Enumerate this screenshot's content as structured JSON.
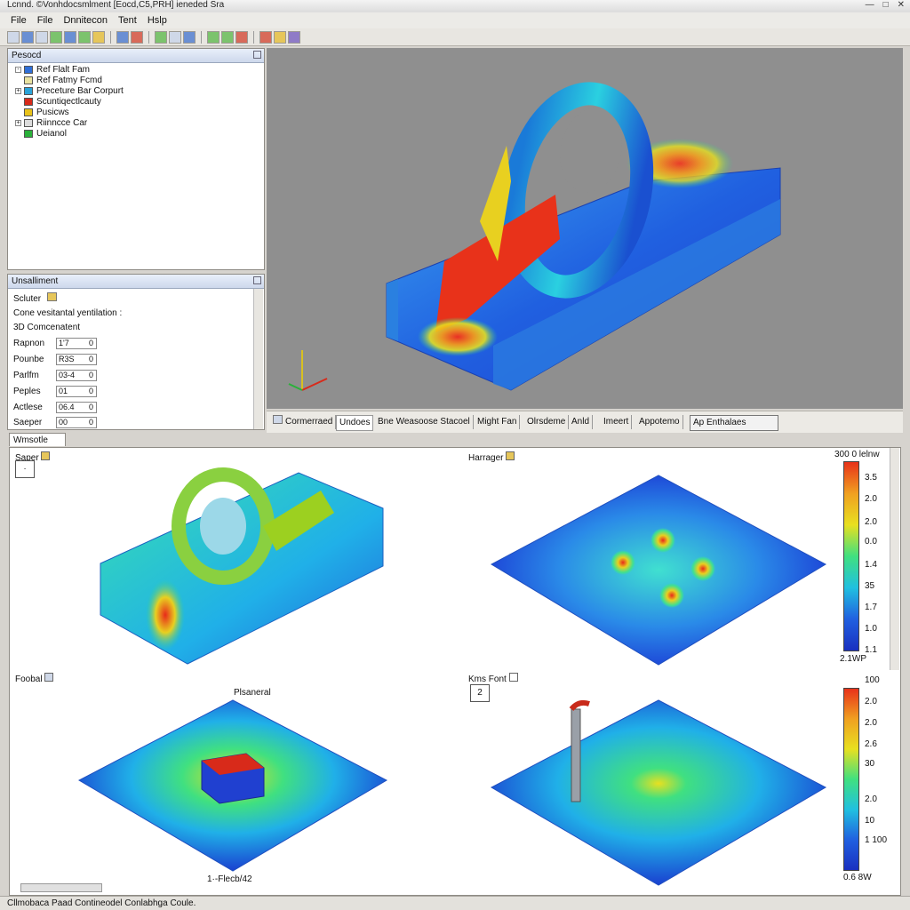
{
  "window": {
    "title": "Lcnnd. ©Vonhdocsmlment [Eocd,C5,PRH] ieneded Sra"
  },
  "menu": [
    "File",
    "File",
    "Dnnitecon",
    "Tent",
    "Hslp"
  ],
  "project_tree": {
    "title": "Pesocd",
    "items": [
      {
        "label": "Ref Flalt Fam",
        "color": "#2f6fd8"
      },
      {
        "label": "Ref Fatmy Fcmd",
        "color": "#e9e2a0"
      },
      {
        "label": "Preceture Bar Corpurt",
        "color": "#2aa3d8"
      },
      {
        "label": "Scuntiqectlcauty",
        "color": "#d82a1a"
      },
      {
        "label": "Pusicws",
        "color": "#e8c21a"
      },
      {
        "label": "Riinncce Car",
        "color": "#dcdcdc"
      },
      {
        "label": "Ueianol",
        "color": "#2ab13a"
      }
    ]
  },
  "properties": {
    "title": "Unsalliment",
    "solver_label": "Scluter",
    "description": "Cone vesitantal yentilation :",
    "component": "3D Comcenatent",
    "rows": [
      {
        "label": "Rapnon",
        "value": "1'7"
      },
      {
        "label": "Pounbe",
        "value": "R3S"
      },
      {
        "label": "Parlfm",
        "value": "03-4"
      },
      {
        "label": "Peples",
        "value": "01"
      },
      {
        "label": "Actlese",
        "value": "06.4"
      },
      {
        "label": "Saeper",
        "value": "00"
      }
    ]
  },
  "viewport_tabs": [
    "Cormerraed",
    "Undoes",
    "Bne Weasoose Stacoel",
    "Might Fan",
    "Olrsdeme",
    "Anld",
    "Imeert",
    "Appotemo",
    "Ap Enthalaes"
  ],
  "lower_panel": {
    "tab_label": "Wmsotle Fam",
    "plots": [
      {
        "label": "Saper",
        "box": "·"
      },
      {
        "label": "Harrager"
      },
      {
        "label": "Foobal",
        "title": "Plsaneral",
        "caption": "1·-Flecb/42"
      },
      {
        "label": "Kms Font",
        "box": "2"
      }
    ],
    "colorbar1": {
      "top": "300 0 lelnw",
      "ticks": [
        "3.5",
        "2.0",
        "2.0",
        "0.0",
        "1.4",
        "35",
        "1.7",
        "1.0",
        "1.1"
      ],
      "bottom": "2.1WP"
    },
    "colorbar2": {
      "top": "100",
      "ticks": [
        "2.0",
        "2.0",
        "2.6",
        "30",
        "2.0",
        "10",
        "1 100"
      ],
      "bottom": "0.6 8W"
    }
  },
  "status": "Cllmobaca Paad Contineodel Conlabhga Coule."
}
